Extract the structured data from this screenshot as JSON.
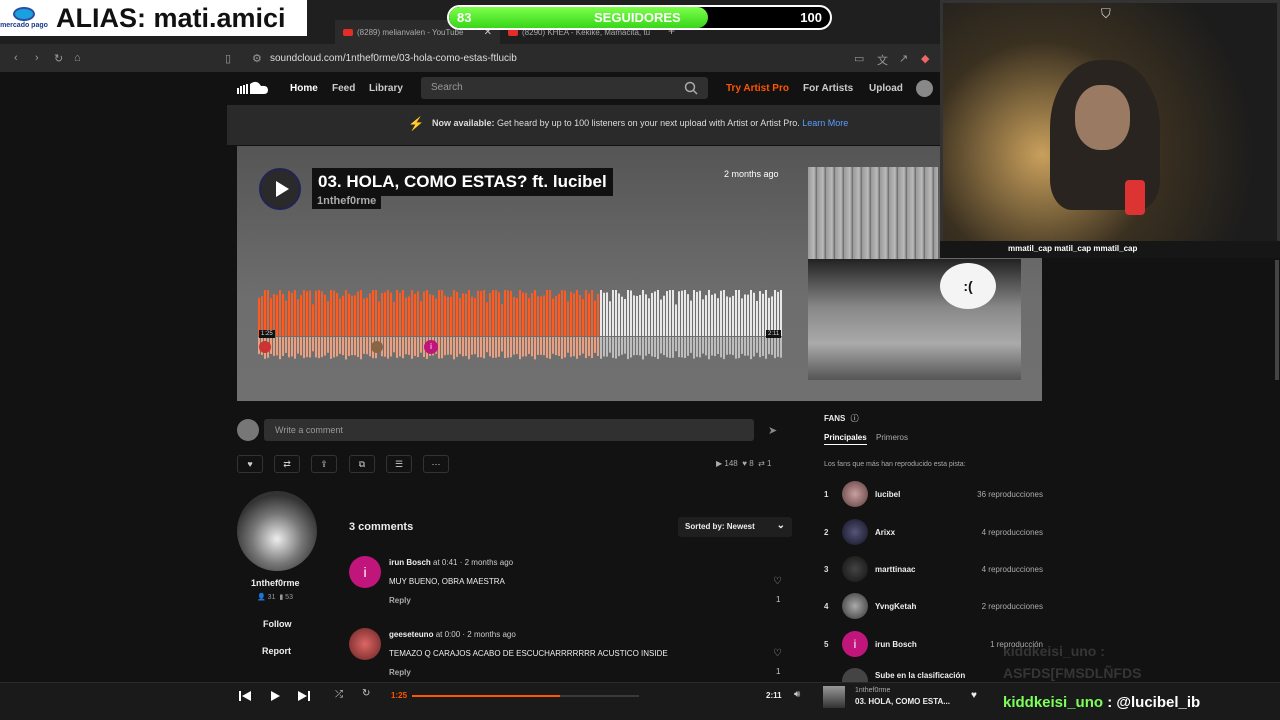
{
  "overlay": {
    "alias_brand": "mercado pago",
    "alias_text": "ALIAS: mati.amici",
    "followers_current": "83",
    "followers_label": "SEGUIDORES",
    "followers_goal": "100",
    "followers_fraction": 0.83,
    "social_handles": "mmatil_cap   matil_cap   mmatil_cap",
    "chat_ghost_1": "kiddkeisi_uno :",
    "chat_ghost_2": "ASFDS[FMSDLÑFDS",
    "chat_user": "kiddkeisi_uno",
    "chat_message": ": @lucibel_ib",
    "colors": {
      "bar_green": "#5ae52a",
      "chat_green": "#7dff5a"
    }
  },
  "browser": {
    "tabs": [
      {
        "label": "(8289) melianvalen - YouTube",
        "icon": "youtube-icon"
      },
      {
        "label": "(8290) KHEA - Kekike, Mamacita, tu",
        "icon": "youtube-icon"
      }
    ],
    "url": "soundcloud.com/1nthef0rme/03-hola-como-estas-ftlucib"
  },
  "nav": {
    "home": "Home",
    "feed": "Feed",
    "library": "Library",
    "search_placeholder": "Search",
    "try_pro": "Try Artist Pro",
    "for_artists": "For Artists",
    "upload": "Upload"
  },
  "promo": {
    "bold": "Now available:",
    "text": "Get heard by up to 100 listeners on your next upload with Artist or Artist Pro.",
    "link": "Learn More"
  },
  "track": {
    "title": "03. HOLA, COMO ESTAS? ft. lucibel",
    "artist": "1nthef0rme",
    "posted": "2 months ago",
    "bubble_text": ":(",
    "elapsed": "1:25",
    "duration": "2:11",
    "progress_fraction": 0.65
  },
  "comment_box": {
    "placeholder": "Write a comment"
  },
  "stats": {
    "plays": "148",
    "likes": "8",
    "reposts": "1"
  },
  "artist_card": {
    "name": "1nthef0rme",
    "followers": "31",
    "tracks": "53",
    "follow": "Follow",
    "report": "Report"
  },
  "comments": {
    "count_label": "3 comments",
    "sort_label": "Sorted by: Newest",
    "items": [
      {
        "user": "irun Bosch",
        "at": "at",
        "time": "0:41",
        "ago": "· 2 months ago",
        "text": "MUY BUENO, OBRA MAESTRA",
        "reply": "Reply",
        "likes": "1"
      },
      {
        "user": "geeseteuno",
        "at": "at",
        "time": "0:00",
        "ago": "· 2 months ago",
        "text": "TEMAZO Q CARAJOS ACABO DE ESCUCHARRRRRRR ACUSTICO INSIDE",
        "reply": "Reply",
        "likes": "1"
      }
    ]
  },
  "fans": {
    "title": "FANS",
    "tab_top": "Principales",
    "tab_first": "Primeros",
    "subtitle": "Los fans que más han reproducido esta pista:",
    "items": [
      {
        "rank": "1",
        "name": "lucibel",
        "plays": "36 reproducciones"
      },
      {
        "rank": "2",
        "name": "Arixx",
        "plays": "4 reproducciones"
      },
      {
        "rank": "3",
        "name": "marttinaac",
        "plays": "4 reproducciones"
      },
      {
        "rank": "4",
        "name": "YvngKetah",
        "plays": "2 reproducciones"
      },
      {
        "rank": "5",
        "name": "irun Bosch",
        "plays": "1 reproducción"
      }
    ],
    "climb": "Sube en la clasificación"
  },
  "player": {
    "elapsed": "1:25",
    "duration": "2:11",
    "artist": "1nthef0rme",
    "title": "03. HOLA, COMO ESTA..."
  }
}
